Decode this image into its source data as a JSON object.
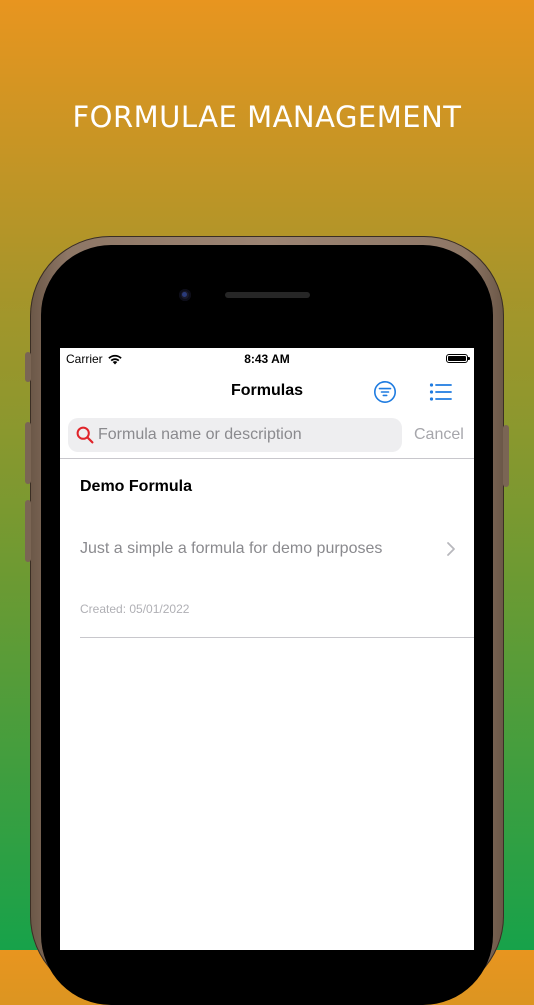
{
  "headline": "FORMULAE MANAGEMENT",
  "status_bar": {
    "carrier": "Carrier",
    "time": "8:43 AM"
  },
  "nav": {
    "title": "Formulas",
    "filter_icon": "filter-circle-icon",
    "list_icon": "list-bullet-icon"
  },
  "search": {
    "placeholder": "Formula name or description",
    "value": "",
    "cancel_label": "Cancel"
  },
  "formulas": [
    {
      "name": "Demo Formula",
      "description": "Just a simple a formula for demo purposes",
      "created": "Created: 05/01/2022"
    }
  ],
  "colors": {
    "accent": "#1E7BE0",
    "search_icon": "#E0242A",
    "gradient_top": "#E8951F",
    "gradient_bottom": "#17A24A"
  }
}
